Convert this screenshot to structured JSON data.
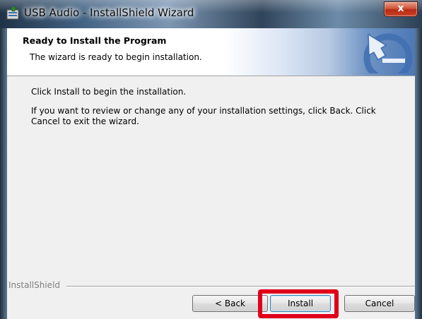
{
  "window": {
    "title": "USB Audio - InstallShield Wizard",
    "close_label": "x",
    "app_icon": "installer-icon"
  },
  "banner": {
    "title": "Ready to Install the Program",
    "subtitle": "The wizard is ready to begin installation.",
    "logo_icon": "installshield-arrow-logo"
  },
  "body": {
    "line1": "Click Install to begin the installation.",
    "line2": "If you want to review or change any of your installation settings, click Back. Click Cancel to exit the wizard."
  },
  "footer": {
    "brand": "InstallShield"
  },
  "buttons": {
    "back": "< Back",
    "install": "Install",
    "cancel": "Cancel"
  },
  "colors": {
    "highlight": "#e0001a",
    "banner_blue": "#4d78b5"
  }
}
